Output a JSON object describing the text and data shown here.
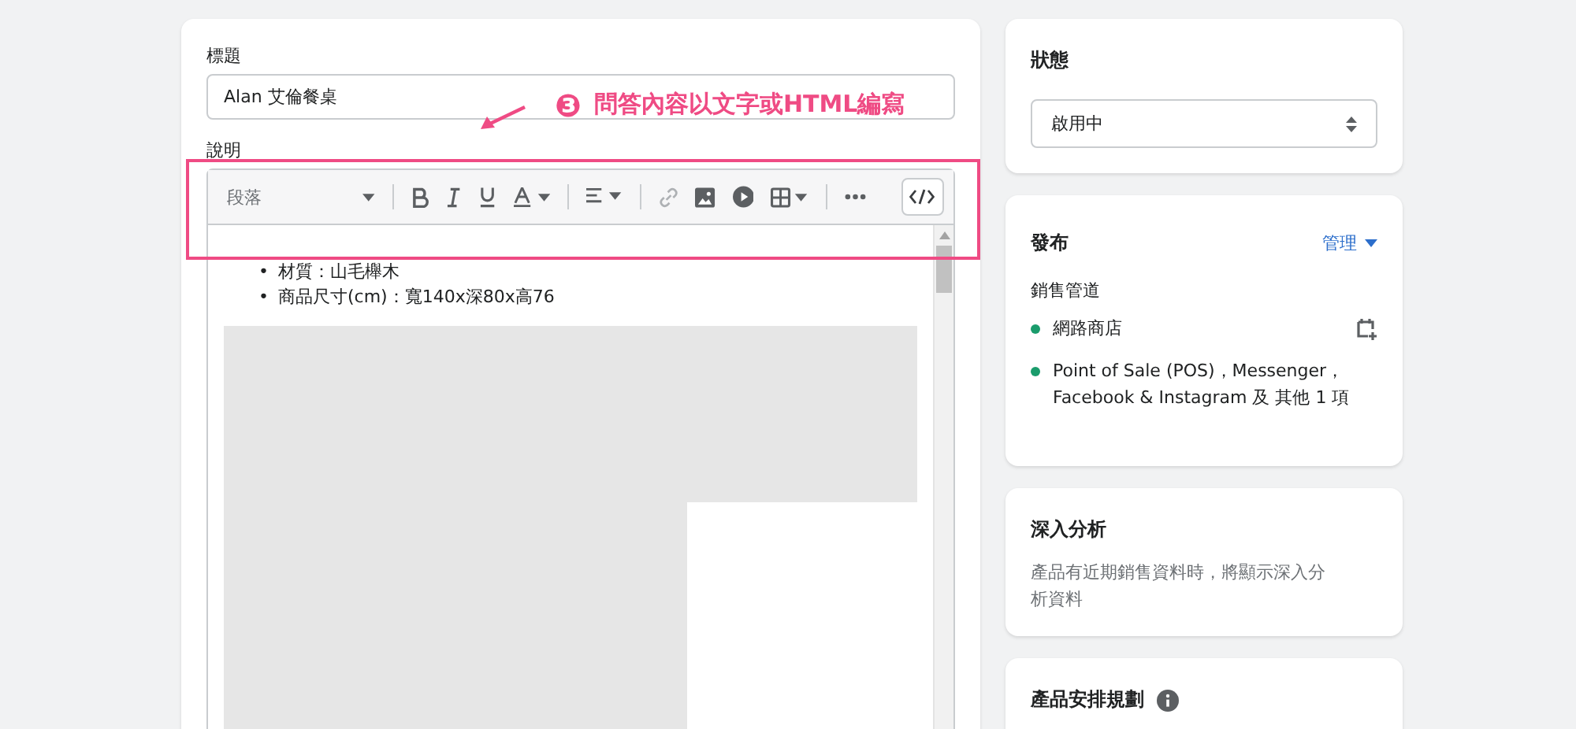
{
  "product": {
    "title_label": "標題",
    "title_value": "Alan 艾倫餐桌",
    "description_label": "說明",
    "editor": {
      "format": "段落",
      "content_items": [
        {
          "marker": "•",
          "text": "材質：山毛櫸木"
        },
        {
          "marker": "•",
          "text": "商品尺寸(cm)：寬140x深80x高76"
        }
      ]
    }
  },
  "annotation": {
    "number": "❸",
    "text": "問答內容以文字或HTML編寫"
  },
  "status": {
    "title": "狀態",
    "value": "啟用中"
  },
  "publishing": {
    "title": "發布",
    "manage": "管理",
    "section_label": "銷售管道",
    "channels": [
      {
        "name": "網路商店",
        "kind": "store"
      },
      {
        "name": "Point of Sale (POS)，Messenger，Facebook & Instagram 及 其他 1 項",
        "kind": "other"
      }
    ]
  },
  "insights": {
    "title": "深入分析",
    "text": "產品有近期銷售資料時，將顯示深入分析資料"
  },
  "scheduling": {
    "title": "產品安排規劃"
  }
}
